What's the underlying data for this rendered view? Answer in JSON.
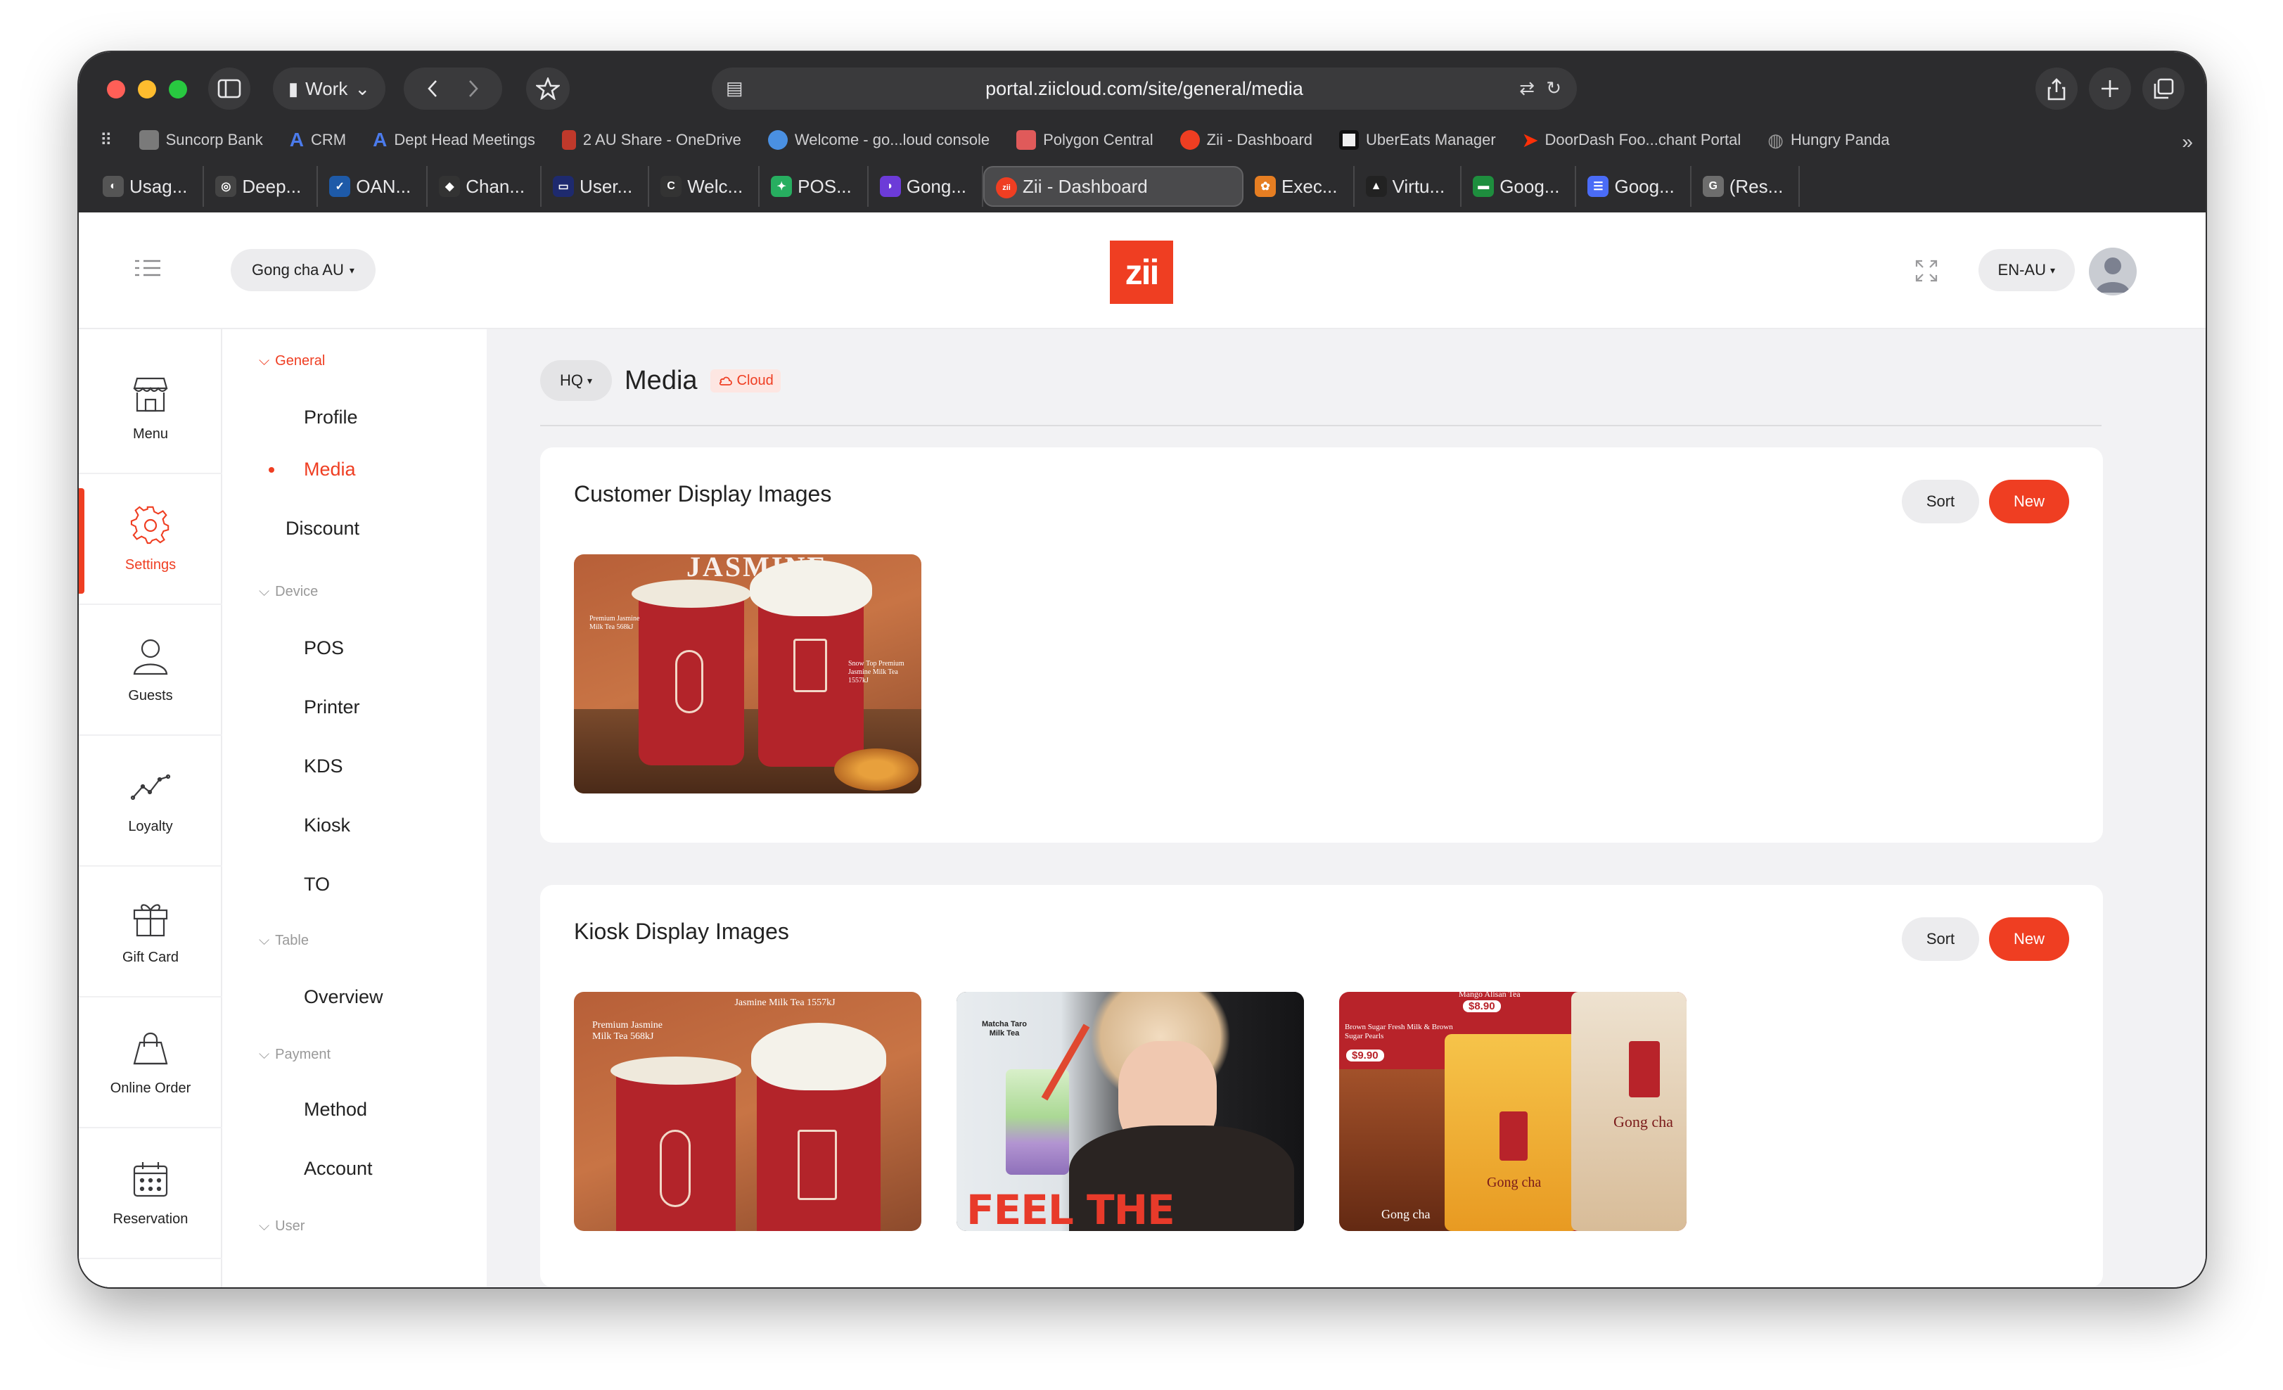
{
  "browser": {
    "profile_label": "Work",
    "url": "portal.ziicloud.com/site/general/media",
    "bookmarks": [
      {
        "label": "Suncorp Bank",
        "color": "#7a7a7a"
      },
      {
        "label": "CRM",
        "color": "#3b6fd8"
      },
      {
        "label": "Dept Head Meetings",
        "color": "#3b6fd8"
      },
      {
        "label": "2 AU Share - OneDrive",
        "color": "#c0392b"
      },
      {
        "label": "Welcome - go...loud console",
        "color": "#4a90e2"
      },
      {
        "label": "Polygon Central",
        "color": "#e05a5a"
      },
      {
        "label": "Zii - Dashboard",
        "color": "#ef3e22"
      },
      {
        "label": "UberEats Manager",
        "color": "#111111"
      },
      {
        "label": "DoorDash Foo...chant Portal",
        "color": "#ff3008"
      },
      {
        "label": "Hungry Panda",
        "color": "#9a9a9a"
      }
    ],
    "tabs": [
      {
        "label": "Usag...",
        "color": "#555555",
        "glyph": "◐"
      },
      {
        "label": "Deep...",
        "color": "#444444",
        "glyph": "◎"
      },
      {
        "label": "OAN...",
        "color": "#1e5aa8",
        "glyph": "✓"
      },
      {
        "label": "Chan...",
        "color": "#333333",
        "glyph": "◆"
      },
      {
        "label": "User...",
        "color": "#1e2a6e",
        "glyph": "▭"
      },
      {
        "label": "Welc...",
        "color": "#333333",
        "glyph": "C"
      },
      {
        "label": "POS...",
        "color": "#27ae60",
        "glyph": "✦"
      },
      {
        "label": "Gong...",
        "color": "#6c3bd8",
        "glyph": "◗"
      },
      {
        "label": "Zii - Dashboard",
        "color": "#ef3e22",
        "glyph": "zii",
        "active": true
      },
      {
        "label": "Exec...",
        "color": "#e67e22",
        "glyph": "✿"
      },
      {
        "label": "Virtu...",
        "color": "#222222",
        "glyph": "▲"
      },
      {
        "label": "Goog...",
        "color": "#1e8e3e",
        "glyph": "▬"
      },
      {
        "label": "Goog...",
        "color": "#4a6cf7",
        "glyph": "☰"
      },
      {
        "label": "(Res...",
        "color": "#6d6d6d",
        "glyph": "G"
      }
    ]
  },
  "header": {
    "org": "Gong cha AU",
    "logo": "zii",
    "language": "EN-AU"
  },
  "icon_nav": [
    {
      "label": "Menu",
      "icon": "store-icon"
    },
    {
      "label": "Settings",
      "icon": "gear-icon",
      "active": true
    },
    {
      "label": "Guests",
      "icon": "user-icon"
    },
    {
      "label": "Loyalty",
      "icon": "trend-icon"
    },
    {
      "label": "Gift Card",
      "icon": "gift-icon"
    },
    {
      "label": "Online Order",
      "icon": "bag-icon"
    },
    {
      "label": "Reservation",
      "icon": "calendar-icon"
    }
  ],
  "subnav": {
    "general": "General",
    "profile": "Profile",
    "media": "Media",
    "discount": "Discount",
    "device": "Device",
    "pos": "POS",
    "printer": "Printer",
    "kds": "KDS",
    "kiosk": "Kiosk",
    "to": "TO",
    "table": "Table",
    "overview": "Overview",
    "payment": "Payment",
    "method": "Method",
    "account": "Account",
    "user": "User"
  },
  "page": {
    "scope": "HQ",
    "title": "Media",
    "badge": "Cloud"
  },
  "sections": {
    "customer": {
      "title": "Customer Display Images",
      "sort": "Sort",
      "new": "New"
    },
    "kiosk": {
      "title": "Kiosk Display Images",
      "sort": "Sort",
      "new": "New"
    }
  },
  "image_text": {
    "c1_top": "JASMINE",
    "c1_left": "Premium Jasmine Milk Tea 568kJ",
    "c1_right": "Snow Top Premium Jasmine Milk Tea 1557kJ",
    "k1_left": "Premium Jasmine Milk Tea 568kJ",
    "k1_right": "Jasmine Milk Tea 1557kJ",
    "k2_small": "Matcha Taro Milk Tea",
    "k2_big": "FEEL THE",
    "k3_left": "Brown Sugar Fresh Milk & Brown Sugar Pearls",
    "k3_price1": "$8.90",
    "k3_price2": "$9.90",
    "k3_top": "Mango Alisan Tea",
    "k3_brand": "Gong cha"
  }
}
